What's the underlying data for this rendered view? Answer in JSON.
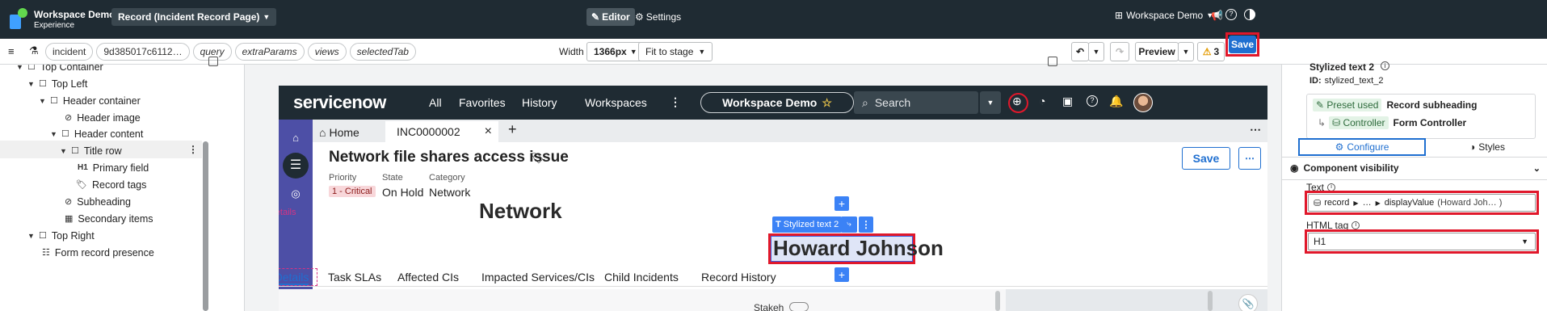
{
  "topbar": {
    "app_title": "Workspace Demo",
    "app_subtitle": "Experience",
    "page_selector": "Record (Incident Record Page)",
    "editor_label": "Editor",
    "settings_label": "Settings",
    "workspace_menu": "Workspace Demo"
  },
  "toolbar": {
    "menu_icon": "hamburger-icon",
    "pills": [
      "incident",
      "9d385017c6112…",
      "query",
      "extraParams",
      "views",
      "selectedTab"
    ],
    "width_label": "Width",
    "width_value": "1366px",
    "fit_value": "Fit to stage",
    "preview_label": "Preview",
    "warning_count": "3",
    "save_label": "Save"
  },
  "tree": {
    "items": [
      {
        "label": "Top Container",
        "icon": "box-icon"
      },
      {
        "label": "Top Left",
        "icon": "box-icon"
      },
      {
        "label": "Header container",
        "icon": "box-icon"
      },
      {
        "label": "Header image",
        "icon": "hidden-eye-icon"
      },
      {
        "label": "Header content",
        "icon": "box-icon"
      },
      {
        "label": "Title row",
        "icon": "box-icon"
      },
      {
        "label": "Primary field",
        "icon": "h1-icon",
        "icon_text": "H1"
      },
      {
        "label": "Record tags",
        "icon": "tag-icon"
      },
      {
        "label": "Subheading",
        "icon": "hidden-eye-icon"
      },
      {
        "label": "Secondary items",
        "icon": "grid-icon"
      },
      {
        "label": "Top Right",
        "icon": "box-icon"
      },
      {
        "label": "Form record presence",
        "icon": "presence-icon"
      }
    ]
  },
  "sn": {
    "logo": "servicenow",
    "nav": [
      "All",
      "Favorites",
      "History",
      "Workspaces"
    ],
    "workspace_pill": "Workspace Demo",
    "search_placeholder": "Search",
    "tabs": {
      "home": "Home",
      "record": "INC0000002",
      "close": "×",
      "add": "+"
    },
    "record_title": "Network file shares access issue",
    "record_save": "Save",
    "fields": [
      {
        "label": "Priority",
        "value": "1 - Critical"
      },
      {
        "label": "State",
        "value": "On Hold"
      },
      {
        "label": "Category",
        "value": "Network"
      }
    ],
    "subheading": "Network",
    "details_tag": "Details",
    "stylized_label": "Stylized text 2",
    "assigned_name": "Howard Johnson",
    "form_tabs": [
      "Details",
      "Task SLAs",
      "Affected CIs",
      "Impacted Services/CIs",
      "Child Incidents",
      "Record History"
    ],
    "form_partial_label": "Stakeh"
  },
  "panel": {
    "title": "Stylized text 2",
    "id_label": "ID:",
    "id_value": "stylized_text_2",
    "preset_badge": "Preset used",
    "preset_value": "Record subheading",
    "controller_badge": "Controller",
    "controller_value": "Form Controller",
    "tab_configure": "Configure",
    "tab_styles": "Styles",
    "section_visibility": "Component visibility",
    "text_label": "Text",
    "text_path": [
      "record",
      "…",
      "displayValue"
    ],
    "text_preview": "(Howard Joh… )",
    "html_tag_label": "HTML tag",
    "html_tag_value": "H1"
  },
  "colors": {
    "topbar": "#1f2b33",
    "accent": "#1f6fd0",
    "highlight": "#e0182b",
    "rail": "#4d4fa6",
    "tag_pink": "#d63384",
    "selection": "#3b5bdb"
  }
}
